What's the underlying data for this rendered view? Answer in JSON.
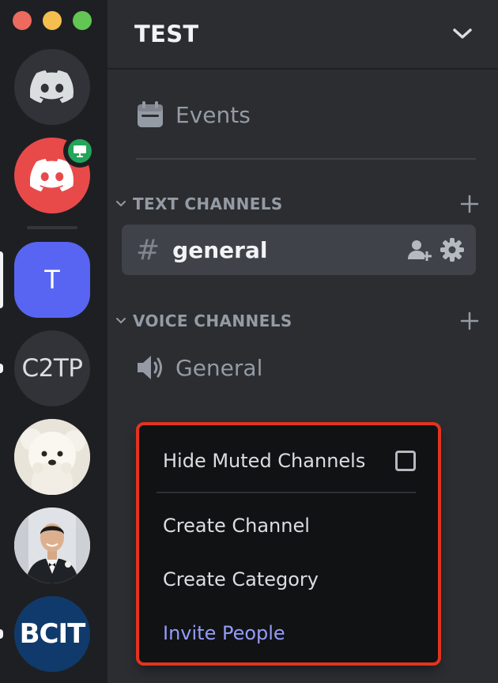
{
  "window": {
    "traffic_lights": [
      "close",
      "minimize",
      "maximize"
    ]
  },
  "servers": [
    {
      "name": "home",
      "icon": "discord-logo-icon"
    },
    {
      "name": "red-server",
      "icon": "discord-logo-icon",
      "badge_icon": "stage-icon"
    },
    {
      "name": "T",
      "label": "T",
      "active": true
    },
    {
      "name": "C2TP",
      "label": "C2TP",
      "unread": true
    },
    {
      "name": "dog-avatar",
      "icon": "dog-photo"
    },
    {
      "name": "person-avatar",
      "icon": "person-photo"
    },
    {
      "name": "BCIT",
      "label": "BCIT",
      "unread": true
    }
  ],
  "header": {
    "server_name": "TEST",
    "dropdown_icon": "chevron-down-icon"
  },
  "events": {
    "label": "Events",
    "icon": "calendar-icon"
  },
  "categories": [
    {
      "name": "TEXT CHANNELS"
    },
    {
      "name": "VOICE CHANNELS"
    }
  ],
  "text_channel": {
    "name": "general",
    "icon": "hash-icon",
    "actions": [
      "invite-icon",
      "settings-icon"
    ]
  },
  "voice_channel": {
    "name": "General",
    "icon": "speaker-icon"
  },
  "context_menu": {
    "hide_muted": "Hide Muted Channels",
    "create_channel": "Create Channel",
    "create_category": "Create Category",
    "invite_people": "Invite People"
  },
  "colors": {
    "rail": "#1e1f22",
    "sidebar": "#2b2d31",
    "menu": "#111214",
    "highlight_border": "#e3331f",
    "invite_text": "#949cf7",
    "blurple": "#5865f2",
    "online_green": "#23a55a"
  }
}
